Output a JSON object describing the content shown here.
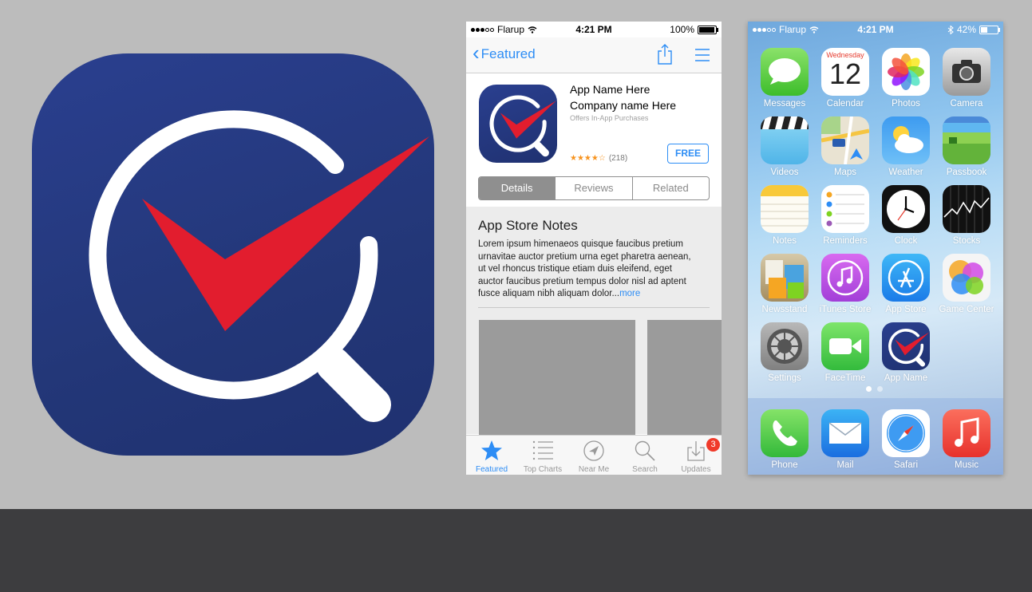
{
  "colors": {
    "icon_blue": "#23367a",
    "check_red": "#e21d2e",
    "ios_blue": "#2d8df5",
    "background_gray": "#bcbcbc",
    "bottom_band": "#3d3d3f"
  },
  "app_store": {
    "status": {
      "carrier": "Flarup",
      "time": "4:21 PM",
      "battery": "100%"
    },
    "nav": {
      "back_label": "Featured"
    },
    "app": {
      "name": "App Name Here",
      "company": "Company name Here",
      "offers": "Offers In-App Purchases",
      "stars": "★★★★☆",
      "rating_count": "(218)",
      "price_button": "FREE"
    },
    "segments": [
      "Details",
      "Reviews",
      "Related"
    ],
    "notes": {
      "title": "App Store Notes",
      "body": "Lorem ipsum himenaeos quisque  faucibus pretium urnavitae auctor  pretium urna eget pharetra aenean, ut vel rhoncus tristique etiam duis eleifend, eget auctor faucibus pretium tempus dolor nisl ad aptent fusce aliquam nibh aliquam dolor...",
      "more": "more"
    },
    "tabs": [
      {
        "label": "Featured",
        "icon": "star-icon"
      },
      {
        "label": "Top Charts",
        "icon": "list-icon"
      },
      {
        "label": "Near Me",
        "icon": "location-icon"
      },
      {
        "label": "Search",
        "icon": "search-icon"
      },
      {
        "label": "Updates",
        "icon": "download-icon",
        "badge": "3"
      }
    ]
  },
  "home_screen": {
    "status": {
      "carrier": "Flarup",
      "time": "4:21 PM",
      "battery": "42%"
    },
    "calendar": {
      "weekday": "Wednesday",
      "day": "12"
    },
    "apps": [
      "Messages",
      "Calendar",
      "Photos",
      "Camera",
      "Videos",
      "Maps",
      "Weather",
      "Passbook",
      "Notes",
      "Reminders",
      "Clock",
      "Stocks",
      "Newsstand",
      "iTunes Store",
      "App Store",
      "Game Center",
      "Settings",
      "FaceTime",
      "App Name"
    ],
    "dock": [
      "Phone",
      "Mail",
      "Safari",
      "Music"
    ]
  }
}
